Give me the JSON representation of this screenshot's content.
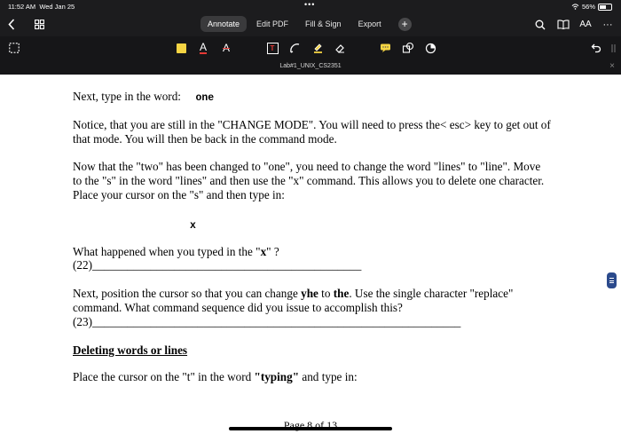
{
  "status": {
    "time": "11:52 AM",
    "date": "Wed Jan 25",
    "dots": "•••",
    "battery": "56%"
  },
  "tabs": [
    {
      "label": "Annotate",
      "active": true
    },
    {
      "label": "Edit PDF",
      "active": false
    },
    {
      "label": "Fill & Sign",
      "active": false
    },
    {
      "label": "Export",
      "active": false
    }
  ],
  "plus_label": "+",
  "text_size_label": "AA",
  "more_label": "···",
  "tools": [
    {
      "name": "note-tool",
      "label": ""
    },
    {
      "name": "text-color-tool",
      "label": "A"
    },
    {
      "name": "strikethrough-tool",
      "label": "A"
    },
    {
      "name": "textbox-tool",
      "label": "T"
    }
  ],
  "colors": {
    "note_yellow": "#f5d443",
    "red": "#e53935",
    "accent": "#2b4a8c"
  },
  "file": {
    "name": "Lab#1_UNIX_CS2351",
    "close": "×"
  },
  "doc": {
    "line1_prefix": "Next, type in the word:",
    "line1_word": "one",
    "para2": "Notice, that you are still in the \"CHANGE MODE\". You will need to press the< esc> key to get out of that mode. You will then be back in the command mode.",
    "para3": "Now that the \"two\" has been changed to \"one\", you need to change the word \"lines\" to \"line\". Move to the \"s\" in the word \"lines\" and then use the \"x\" command. This allows you to delete one character. Place your cursor on the \"s\" and then type in:",
    "x_cmd": "x",
    "q22_a": "What happened when you typed in the \"",
    "q22_b": "x",
    "q22_c": "\" ?",
    "q22_num": "(22)",
    "q22_blank": "______________________________________________",
    "q23_a": "Next, position the cursor so that you can change ",
    "q23_b": "yhe",
    "q23_c": " to ",
    "q23_d": "the",
    "q23_e": ". Use the single character \"replace\" command. What command sequence did you issue to accomplish this?",
    "q23_num": "(23)",
    "q23_blank": "_______________________________________________________________",
    "heading": "Deleting words or lines",
    "last_a": "Place the cursor on the \"t\" in the word ",
    "last_b": "\"typing\"",
    "last_c": " and type in:",
    "page_label": "Page 8 of 13"
  }
}
